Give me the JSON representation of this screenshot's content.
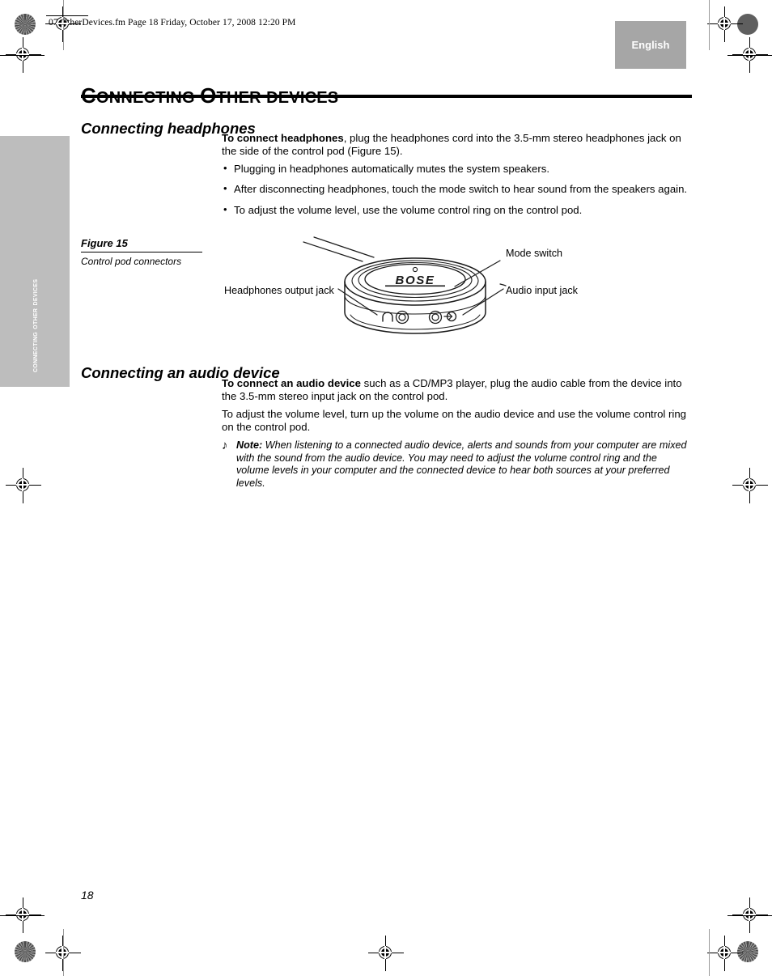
{
  "document": {
    "file_header": "07.OtherDevices.fm  Page 18  Friday, October 17, 2008  12:20 PM",
    "page_number": "18",
    "language_tab": "English",
    "side_tab": "Connecting Other devices"
  },
  "chapter": {
    "title_part1": "C",
    "title_part2": "ONNECTING",
    "title_part3": "O",
    "title_part4": "THER",
    "title_part5": "DEVICES",
    "title_full": "CONNECTING OTHER DEVICES"
  },
  "sections": {
    "headphones": {
      "heading": "Connecting headphones",
      "intro_bold": "To connect headphones",
      "intro_rest": ", plug the headphones cord into the 3.5-mm stereo headphones jack on the side of the control pod (Figure 15).",
      "bullets": [
        "Plugging in headphones automatically mutes the system speakers.",
        "After disconnecting headphones, touch the mode switch to hear sound from the speakers again.",
        "To adjust the volume level, use the volume control ring on the control pod."
      ]
    },
    "audio_device": {
      "heading": "Connecting an audio device",
      "intro_bold": "To connect an audio device",
      "intro_rest": " such as a CD/MP3 player, plug the audio cable from the device into the 3.5-mm stereo input jack on the control pod.",
      "paragraph2": "To adjust the volume level, turn up the volume on the audio device and use the volume control ring on the control pod.",
      "note": {
        "icon": "music-note-icon",
        "icon_glyph": "♪",
        "label": "Note:",
        "text": " When listening to a connected audio device, alerts and sounds from your computer are mixed with the sound from the audio device. You may need to adjust the volume control ring and the volume levels in your computer and the connected device to hear both sources at your preferred levels."
      }
    }
  },
  "figure": {
    "number": "Figure 15",
    "caption": "Control pod connectors",
    "brand_mark": "BOSE",
    "callouts": {
      "mode_switch": "Mode switch",
      "headphones_output_jack": "Headphones output jack",
      "audio_input_jack": "Audio input jack"
    }
  },
  "colors": {
    "tab_gray": "#a6a6a6",
    "side_tab_gray": "#bdbdbd",
    "text_black": "#000000",
    "page_white": "#ffffff"
  }
}
